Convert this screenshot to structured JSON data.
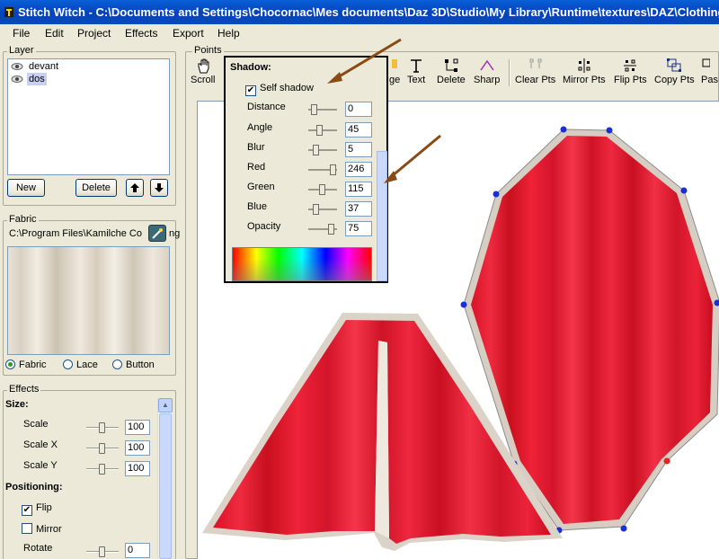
{
  "window": {
    "title": "Stitch Witch - C:\\Documents and Settings\\Chocornac\\Mes documents\\Daz 3D\\Studio\\My Library\\Runtime\\textures\\DAZ\\Clothing\\"
  },
  "menu": [
    "File",
    "Edit",
    "Project",
    "Effects",
    "Export",
    "Help"
  ],
  "layer": {
    "group_label": "Layer",
    "items": [
      {
        "name": "devant"
      },
      {
        "name": "dos",
        "selected": true
      }
    ],
    "new_label": "New",
    "delete_label": "Delete"
  },
  "fabric": {
    "group_label": "Fabric",
    "path": "C:\\Program Files\\Kamilche Co",
    "path_suffix": "ng",
    "options": [
      "Fabric",
      "Lace",
      "Button"
    ],
    "selected": "Fabric"
  },
  "effects": {
    "group_label": "Effects",
    "size_label": "Size:",
    "scale_label": "Scale",
    "scale_value": "100",
    "scalex_label": "Scale X",
    "scalex_value": "100",
    "scaley_label": "Scale Y",
    "scaley_value": "100",
    "positioning_label": "Positioning:",
    "flip_label": "Flip",
    "flip_checked": true,
    "mirror_label": "Mirror",
    "mirror_checked": false,
    "rotate_label": "Rotate",
    "rotate_value": "0"
  },
  "points": {
    "group_label": "Points",
    "tools": [
      "Scroll",
      "ge",
      "Text",
      "Delete",
      "Sharp",
      "Clear Pts",
      "Mirror Pts",
      "Flip Pts",
      "Copy Pts",
      "Pas"
    ]
  },
  "shadow": {
    "title": "Shadow:",
    "self_shadow_label": "Self shadow",
    "self_shadow_checked": true,
    "fields": [
      {
        "label": "Distance",
        "value": "0",
        "level": 0.15
      },
      {
        "label": "Angle",
        "value": "45",
        "level": 0.35
      },
      {
        "label": "Blur",
        "value": "5",
        "level": 0.2
      },
      {
        "label": "Red",
        "value": "246",
        "level": 0.92
      },
      {
        "label": "Green",
        "value": "115",
        "level": 0.45
      },
      {
        "label": "Blue",
        "value": "37",
        "level": 0.2
      },
      {
        "label": "Opacity",
        "value": "75",
        "level": 0.85
      }
    ]
  },
  "colors": {
    "cloth_red": "#e8172e",
    "cloth_rim": "#d8cfc4",
    "point_blue": "#1a2fd8",
    "point_red": "#e82020",
    "arrow": "#8a4a14"
  }
}
